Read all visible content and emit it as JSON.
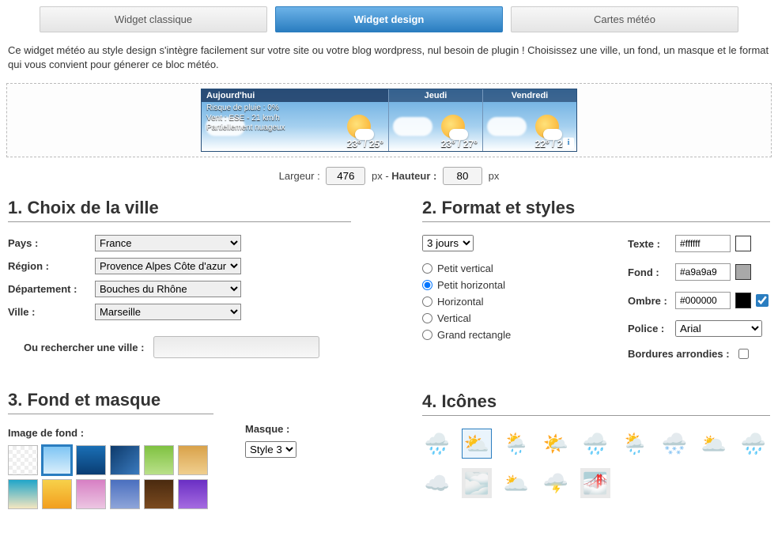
{
  "tabs": {
    "classic": "Widget classique",
    "design": "Widget design",
    "maps": "Cartes météo"
  },
  "intro": "Ce widget météo au style design s'intègre facilement sur votre site ou votre blog wordpress, nul besoin de plugin ! Choisissez une ville, un fond, un masque et le format qui vous convient pour génerer ce bloc météo.",
  "preview": {
    "day1": {
      "title": "Aujourd'hui",
      "line1": "Risque de pluie : 0%",
      "line2": "Vent : ESE - 21 km/h",
      "line3": "Partiellement nuageux",
      "temp": "23° / 25°"
    },
    "day2": {
      "title": "Jeudi",
      "temp": "23° / 27°"
    },
    "day3": {
      "title": "Vendredi",
      "temp": "22° / 25°"
    }
  },
  "dims": {
    "width_label": "Largeur :",
    "width": "476",
    "px": "px",
    "sep": " - ",
    "height_label": "Hauteur :",
    "height": "80"
  },
  "step1": {
    "title": "1. Choix de la ville",
    "country_label": "Pays :",
    "country": "France",
    "region_label": "Région :",
    "region": "Provence Alpes Côte d'azur",
    "dept_label": "Département :",
    "dept": "Bouches du Rhône",
    "city_label": "Ville :",
    "city": "Marseille",
    "search_label": "Ou rechercher une ville :"
  },
  "step2": {
    "title": "2. Format et styles",
    "days_sel": "3 jours",
    "opts": {
      "pv": "Petit vertical",
      "ph": "Petit horizontal",
      "h": "Horizontal",
      "v": "Vertical",
      "gr": "Grand rectangle"
    },
    "text_label": "Texte :",
    "text_val": "#ffffff",
    "bg_label": "Fond :",
    "bg_val": "#a9a9a9",
    "shadow_label": "Ombre :",
    "shadow_val": "#000000",
    "font_label": "Police :",
    "font_val": "Arial",
    "rounded_label": "Bordures arrondies :"
  },
  "step3": {
    "title": "3. Fond et masque",
    "bg_label": "Image de fond :",
    "mask_label": "Masque :",
    "mask_val": "Style 3"
  },
  "step4": {
    "title": "4. Icônes"
  }
}
